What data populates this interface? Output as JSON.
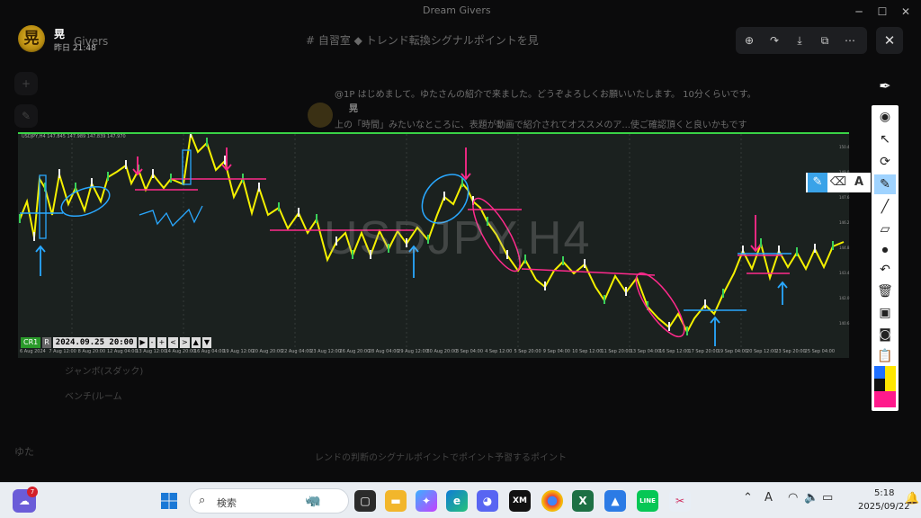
{
  "window": {
    "title": "Dream Givers",
    "controls": [
      "─",
      "☐",
      "✕"
    ]
  },
  "post": {
    "author_glyph": "晃",
    "author": "晃",
    "time": "昨日 21:48",
    "server": "Givers"
  },
  "background": {
    "channel_header": "# 自習室 ◆ トレンド転換シグナルポイントを見",
    "message_line1": "@1P はじめまして。ゆたさんの紹介で来ました。どうぞよろしくお願いいたします。 10分くらいです。",
    "message_user": "晃",
    "message_line2": "上の「時間」みたいなところに、表題が動画で紹介されてオススメのア...使ご確認頂くと良いかもです",
    "below_chart1": "ジャンボ(スダック)",
    "below_chart2": "ベンチ(ルーム",
    "bottom_user": "ゆた",
    "bottom_input": "レンドの判断のシグナルポイントでポイント予習するポイント"
  },
  "viewer_tools": [
    "zoom-icon",
    "rotate-icon",
    "download-icon",
    "open-external-icon",
    "more-icon"
  ],
  "viewer_close": "✕",
  "chart": {
    "header": "USDJPY,H4 147.845 147.989 147.839 147.970",
    "watermark": "USDJPY,H4",
    "cr_label": "CR1",
    "r_label": "R",
    "current_date": "2024.09.25 20:00",
    "nav_buttons": [
      "▶",
      "-",
      "+",
      "<",
      ">",
      "▲",
      "▼"
    ],
    "time_ticks": [
      "6 Aug 2024",
      "7 Aug 12:00",
      "8 Aug 20:00",
      "12 Aug 04:00",
      "13 Aug 12:00",
      "14 Aug 20:00",
      "16 Aug 04:00",
      "19 Aug 12:00",
      "20 Aug 20:00",
      "22 Aug 04:00",
      "23 Aug 12:00",
      "26 Aug 20:00",
      "28 Aug 04:00",
      "29 Aug 12:00",
      "30 Aug 20:00",
      "3 Sep 04:00",
      "4 Sep 12:00",
      "5 Sep 20:00",
      "9 Sep 04:00",
      "10 Sep 12:00",
      "11 Sep 20:00",
      "13 Sep 04:00",
      "16 Sep 12:00",
      "17 Sep 20:00",
      "19 Sep 04:00",
      "20 Sep 12:00",
      "23 Sep 20:00",
      "25 Sep 04:00"
    ],
    "price_labels": [
      "150.4",
      "149.0",
      "147.6",
      "146.2",
      "144.8",
      "143.4",
      "142.0",
      "140.6"
    ]
  },
  "pen_toolbar": {
    "tools": [
      "eye-icon",
      "cursor-icon",
      "rotate-icon",
      "marker-icon",
      "pen-icon",
      "eraser-icon",
      "dot-icon",
      "undo-icon",
      "trash-icon",
      "screen-icon",
      "camera-icon",
      "clipboard-icon"
    ],
    "sub_tools": [
      "highlighter-icon",
      "eraser-icon"
    ],
    "text_tool": "A",
    "swatches": [
      "#1e6fff",
      "#ffe600",
      "#ff1a8c",
      "#111111"
    ]
  },
  "taskbar": {
    "weather_badge": "7",
    "search_placeholder": "検索",
    "apps": [
      "task-view",
      "explorer",
      "copilot",
      "edge",
      "discord",
      "xm",
      "chrome",
      "excel",
      "photos",
      "line",
      "snipping"
    ],
    "xm_label": "XM",
    "line_label": "LINE",
    "excel_label": "X",
    "ime": "A",
    "time": "5:18",
    "date": "2025/09/22"
  }
}
